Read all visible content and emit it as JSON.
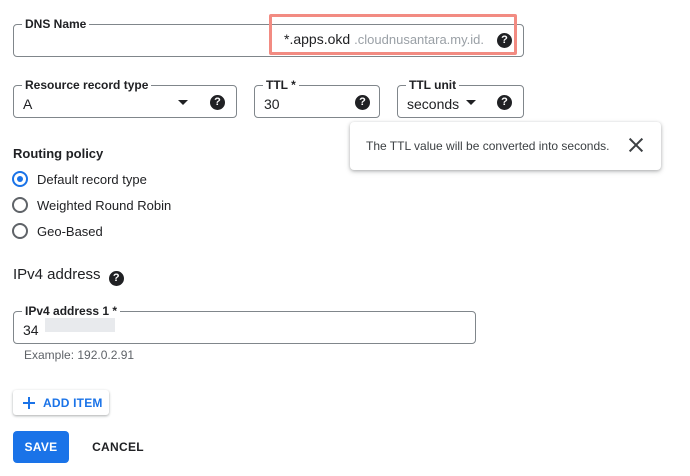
{
  "dns_name": {
    "label": "DNS Name",
    "value_prefix": "*.apps.okd",
    "value_suffix": ".cloudnusantara.my.id."
  },
  "record_type": {
    "label": "Resource record type",
    "value": "A"
  },
  "ttl": {
    "label": "TTL *",
    "value": "30"
  },
  "ttl_unit": {
    "label": "TTL unit",
    "value": "seconds"
  },
  "tooltip": {
    "text": "The TTL value will be converted into seconds."
  },
  "routing_policy": {
    "title": "Routing policy",
    "options": [
      {
        "label": "Default record type",
        "checked": true
      },
      {
        "label": "Weighted Round Robin",
        "checked": false
      },
      {
        "label": "Geo-Based",
        "checked": false
      }
    ]
  },
  "ipv4": {
    "heading": "IPv4 address",
    "field_label": "IPv4 address 1 *",
    "value": "34",
    "hint": "Example: 192.0.2.91"
  },
  "buttons": {
    "add_item": "ADD ITEM",
    "save": "SAVE",
    "cancel": "CANCEL"
  },
  "help_glyph": "?",
  "colors": {
    "accent": "#1a73e8",
    "highlight": "#f28b82",
    "text": "#202124",
    "muted": "#9aa0a6"
  }
}
